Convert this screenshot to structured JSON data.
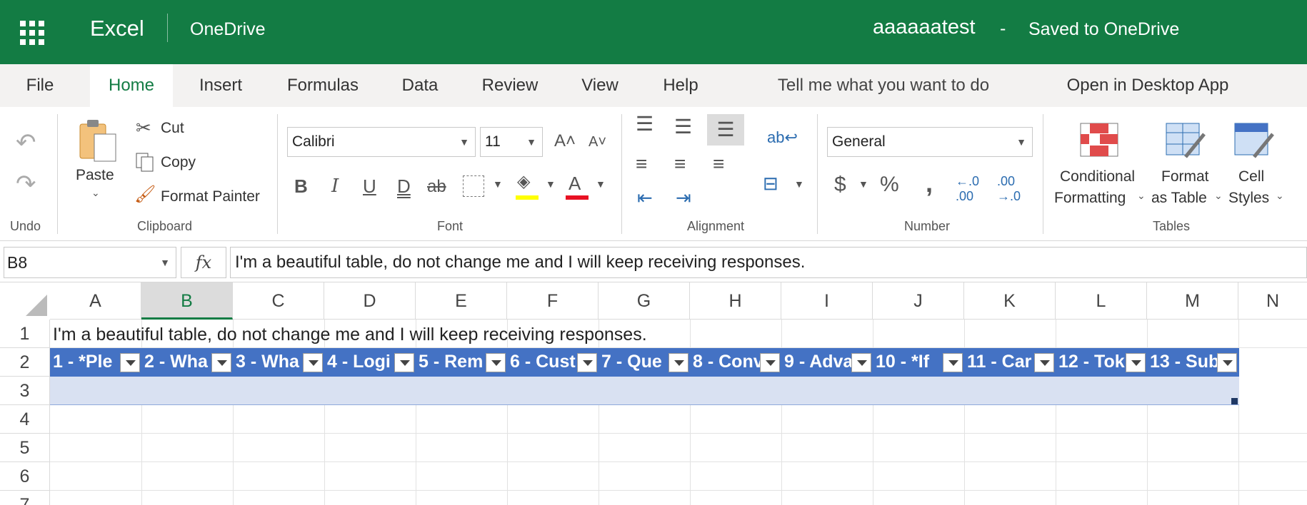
{
  "header": {
    "app_name": "Excel",
    "location": "OneDrive",
    "doc_title": "aaaaaatest",
    "separator": "-",
    "save_status": "Saved to OneDrive"
  },
  "tabs": [
    "File",
    "Home",
    "Insert",
    "Formulas",
    "Data",
    "Review",
    "View",
    "Help",
    "Tell me what you want to do",
    "Open in Desktop App"
  ],
  "ribbon": {
    "groups": {
      "undo": "Undo",
      "clipboard": "Clipboard",
      "font": "Font",
      "alignment": "Alignment",
      "number": "Number",
      "tables": "Tables"
    },
    "paste": "Paste",
    "cut": "Cut",
    "copy": "Copy",
    "format_painter": "Format Painter",
    "font_name": "Calibri",
    "font_size": "11",
    "number_format": "General",
    "conditional_formatting": [
      "Conditional",
      "Formatting"
    ],
    "format_as_table": [
      "Format",
      "as Table"
    ],
    "cell_styles": [
      "Cell",
      "Styles"
    ]
  },
  "formula_bar": {
    "name_box": "B8",
    "fx": "fx",
    "content": "I'm a beautiful table, do not change me and I will keep receiving responses."
  },
  "grid": {
    "columns": [
      "A",
      "B",
      "C",
      "D",
      "E",
      "F",
      "G",
      "H",
      "I",
      "J",
      "K",
      "L",
      "M",
      "N"
    ],
    "selected_column": "B",
    "rows": [
      "1",
      "2",
      "3",
      "4",
      "5",
      "6",
      "7"
    ],
    "a1": "I'm a beautiful table, do not change me and I will keep receiving responses.",
    "table_headers": [
      "1 - *Ple",
      "2 - Wha",
      "3 - Wha",
      "4 - Logi",
      "5 - Rem",
      "6 - Cust",
      "7 - Que",
      "8 - Conv",
      "9 - Adva",
      "10 - *If",
      "11 - Car",
      "12 - Tok",
      "13 - Sub"
    ]
  },
  "colors": {
    "brand": "#137c44",
    "table_header": "#4472c4",
    "table_band": "#d9e1f2"
  }
}
